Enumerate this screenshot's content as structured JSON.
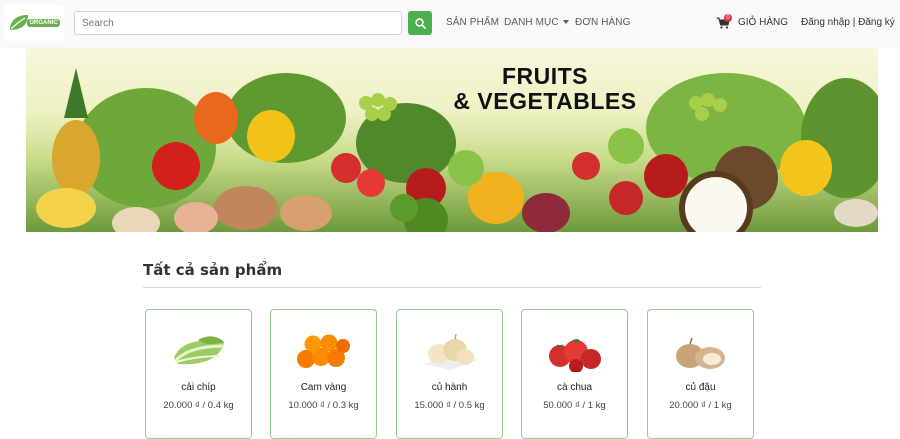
{
  "header": {
    "logo_text": "ORGANIC",
    "search": {
      "placeholder": "Search",
      "value": ""
    },
    "nav": {
      "products": "SẢN PHẨM",
      "categories": "DANH MỤC",
      "orders": "ĐƠN HÀNG"
    },
    "cart": {
      "count": "0",
      "label": "GIỎ HÀNG"
    },
    "auth": {
      "login": "Đăng nhập",
      "separator": "|",
      "register": "Đăng ký"
    }
  },
  "banner": {
    "line1": "FRUITS",
    "line2": "& VEGETABLES"
  },
  "section": {
    "title": "Tất cả sản phẩm"
  },
  "products": [
    {
      "name": "cải chíp",
      "price": "20.000 ₫ / 0.4 kg",
      "icon": "bok-choy-image"
    },
    {
      "name": "Cam vàng",
      "price": "10.000 ₫ / 0.3 kg",
      "icon": "oranges-image"
    },
    {
      "name": "củ hành",
      "price": "15.000 ₫ / 0.5 kg",
      "icon": "onions-image"
    },
    {
      "name": "cà chua",
      "price": "50.000 ₫ / 1 kg",
      "icon": "tomatoes-image"
    },
    {
      "name": "củ đậu",
      "price": "20.000 ₫ / 1 kg",
      "icon": "jicama-image"
    }
  ],
  "colors": {
    "accent": "#4caf50",
    "card_border": "#8fd08f",
    "badge": "#dc3545"
  }
}
